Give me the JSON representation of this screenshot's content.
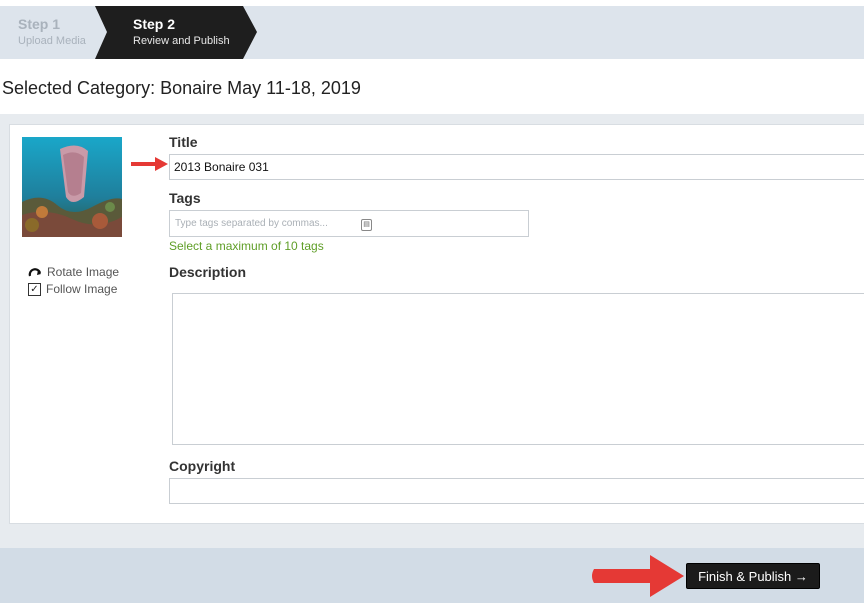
{
  "steps": [
    {
      "title": "Step 1",
      "subtitle": "Upload Media"
    },
    {
      "title": "Step 2",
      "subtitle": "Review and Publish"
    }
  ],
  "category": "Selected Category: Bonaire May 11-18, 2019",
  "image_actions": {
    "rotate": "Rotate Image",
    "follow": "Follow Image",
    "follow_checked": true
  },
  "form": {
    "title_label": "Title",
    "title_value": "2013 Bonaire 031",
    "tags_label": "Tags",
    "tags_placeholder": "Type tags separated by commas...",
    "tags_hint": "Select a maximum of 10 tags",
    "description_label": "Description",
    "description_value": "",
    "copyright_label": "Copyright",
    "copyright_value": ""
  },
  "footer": {
    "finish_label": "Finish & Publish →"
  },
  "colors": {
    "active_step": "#1e1e1e",
    "hint_green": "#5f9e27",
    "arrow_red": "#e53935"
  }
}
